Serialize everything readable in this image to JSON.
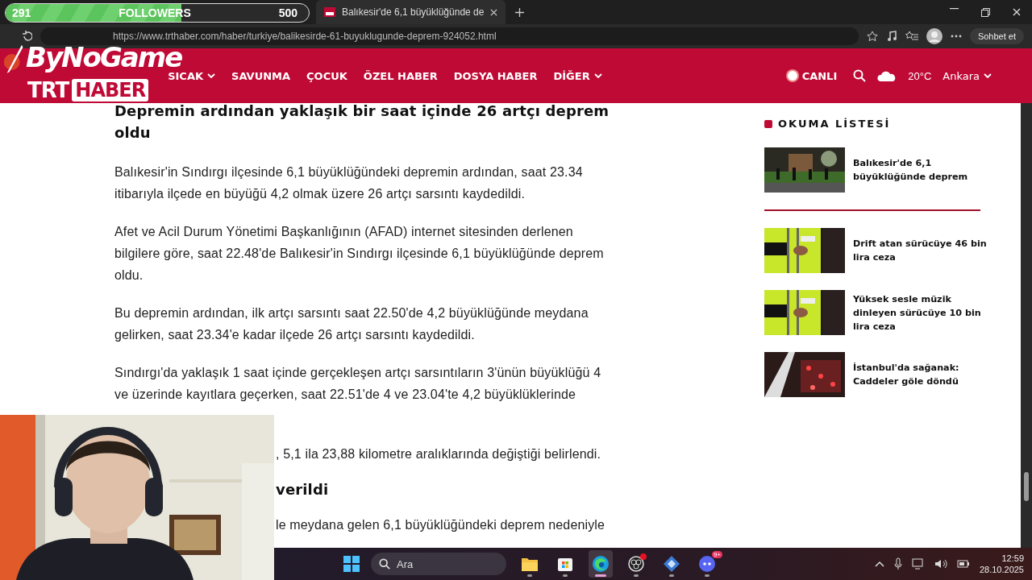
{
  "stream_overlay": {
    "followers": {
      "count": "291",
      "label": "FOLLOWERS",
      "goal": "500",
      "level": 0.58
    },
    "brand": "ByNoGame"
  },
  "browser": {
    "tab": {
      "title": "Balıkesir'de 6,1 büyüklüğünde de"
    },
    "url": "https://www.trthaber.com/haber/turkiye/balikesirde-61-buyuklugunde-deprem-924052.html",
    "chat_button": "Sohbet et"
  },
  "site": {
    "logo": {
      "part_1": "TRT",
      "part_2": "HABER"
    },
    "nav": [
      {
        "label": "SICAK",
        "has_menu": true
      },
      {
        "label": "SAVUNMA",
        "has_menu": false
      },
      {
        "label": "ÇOCUK",
        "has_menu": false
      },
      {
        "label": "ÖZEL HABER",
        "has_menu": false
      },
      {
        "label": "DOSYA HABER",
        "has_menu": false
      },
      {
        "label": "DİĞER",
        "has_menu": true
      }
    ],
    "live": "CANLI",
    "weather": {
      "temp": "20°C",
      "city": "Ankara"
    }
  },
  "article": {
    "blocks": [
      {
        "kind": "heading",
        "text": "Depremin ardından yaklaşık bir saat içinde 26 artçı deprem oldu"
      },
      {
        "kind": "paragraph",
        "text": "Balıkesir'in Sındırgı ilçesinde 6,1 büyüklüğündeki depremin ardından, saat 23.34 itibarıyla ilçede en büyüğü 4,2 olmak üzere 26 artçı sarsıntı kaydedildi."
      },
      {
        "kind": "paragraph",
        "text": "Afet ve Acil Durum Yönetimi Başkanlığının (AFAD) internet sitesinden derlenen bilgilere göre, saat 22.48'de Balıkesir'in Sındırgı ilçesinde 6,1 büyüklüğünde deprem oldu."
      },
      {
        "kind": "paragraph",
        "text": "Bu depremin ardından, ilk artçı sarsıntı saat 22.50'de 4,2 büyüklüğünde meydana gelirken, saat 23.34'e kadar ilçede 26 artçı sarsıntı kaydedildi."
      },
      {
        "kind": "paragraph",
        "text": "Sındırgı'da yaklaşık 1 saat içinde gerçekleşen artçı sarsıntıların 3'ünün büyüklüğü 4 ve üzerinde kayıtlara geçerken, saat 22.51'de 4 ve 23.04'te 4,2 büyüklüklerinde"
      },
      {
        "kind": "paragraph_fragment",
        "text": ", 5,1 ila 23,88 kilometre aralıklarında değiştiği belirlendi."
      },
      {
        "kind": "heading_fragment",
        "text": "verildi"
      },
      {
        "kind": "paragraph_fragment",
        "text": "le meydana gelen 6,1 büyüklüğündeki deprem nedeniyle"
      }
    ]
  },
  "reading_list": {
    "title": "OKUMA LİSTESİ",
    "items": [
      {
        "title": "Balıkesir'de 6,1 büyüklüğünde deprem",
        "divider_after": true
      },
      {
        "title": "Drift atan sürücüye 46 bin lira ceza",
        "divider_after": false
      },
      {
        "title": "Yüksek sesle müzik dinleyen sürücüye 10 bin lira ceza",
        "divider_after": false
      },
      {
        "title": "İstanbul'da sağanak: Caddeler göle döndü",
        "divider_after": false
      }
    ]
  },
  "taskbar": {
    "search": "Ara",
    "apps": [
      {
        "kind": "folder",
        "active": false
      },
      {
        "kind": "store",
        "active": false
      },
      {
        "kind": "browser",
        "active": true
      },
      {
        "kind": "recorder",
        "active": false,
        "notification": true
      },
      {
        "kind": "cube",
        "active": false
      },
      {
        "kind": "chat",
        "active": false,
        "badge": "9+"
      }
    ],
    "time": "12:59",
    "date": "28.10.2025"
  }
}
